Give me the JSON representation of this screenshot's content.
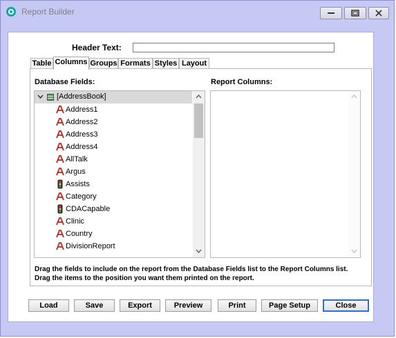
{
  "window": {
    "title": "Report Builder",
    "accent": "#14a6a6"
  },
  "header": {
    "label": "Header Text:",
    "value": ""
  },
  "tabs": [
    {
      "label": "Table",
      "active": false
    },
    {
      "label": "Columns",
      "active": true
    },
    {
      "label": "Groups",
      "active": false
    },
    {
      "label": "Formats",
      "active": false
    },
    {
      "label": "Styles",
      "active": false
    },
    {
      "label": "Layout",
      "active": false
    }
  ],
  "database_fields": {
    "label": "Database Fields:",
    "root": "[AddressBook]",
    "items": [
      {
        "label": "Address1",
        "icon": "text-field-icon"
      },
      {
        "label": "Address2",
        "icon": "text-field-icon"
      },
      {
        "label": "Address3",
        "icon": "text-field-icon"
      },
      {
        "label": "Address4",
        "icon": "text-field-icon"
      },
      {
        "label": "AllTalk",
        "icon": "text-field-icon"
      },
      {
        "label": "Argus",
        "icon": "text-field-icon"
      },
      {
        "label": "Assists",
        "icon": "traffic-light-icon"
      },
      {
        "label": "Category",
        "icon": "text-field-icon"
      },
      {
        "label": "CDACapable",
        "icon": "traffic-light-icon"
      },
      {
        "label": "Clinic",
        "icon": "text-field-icon"
      },
      {
        "label": "Country",
        "icon": "text-field-icon"
      },
      {
        "label": "DivisionReport",
        "icon": "text-field-icon"
      }
    ]
  },
  "report_columns": {
    "label": "Report Columns:",
    "items": []
  },
  "help_text": "Drag the fields to include on the report from the Database Fields list to the Report Columns list. Drag the items to the position you want them printed on the report.",
  "buttons": {
    "load": "Load",
    "save": "Save",
    "export": "Export",
    "preview": "Preview",
    "print": "Print",
    "page_setup": "Page Setup",
    "close": "Close"
  }
}
